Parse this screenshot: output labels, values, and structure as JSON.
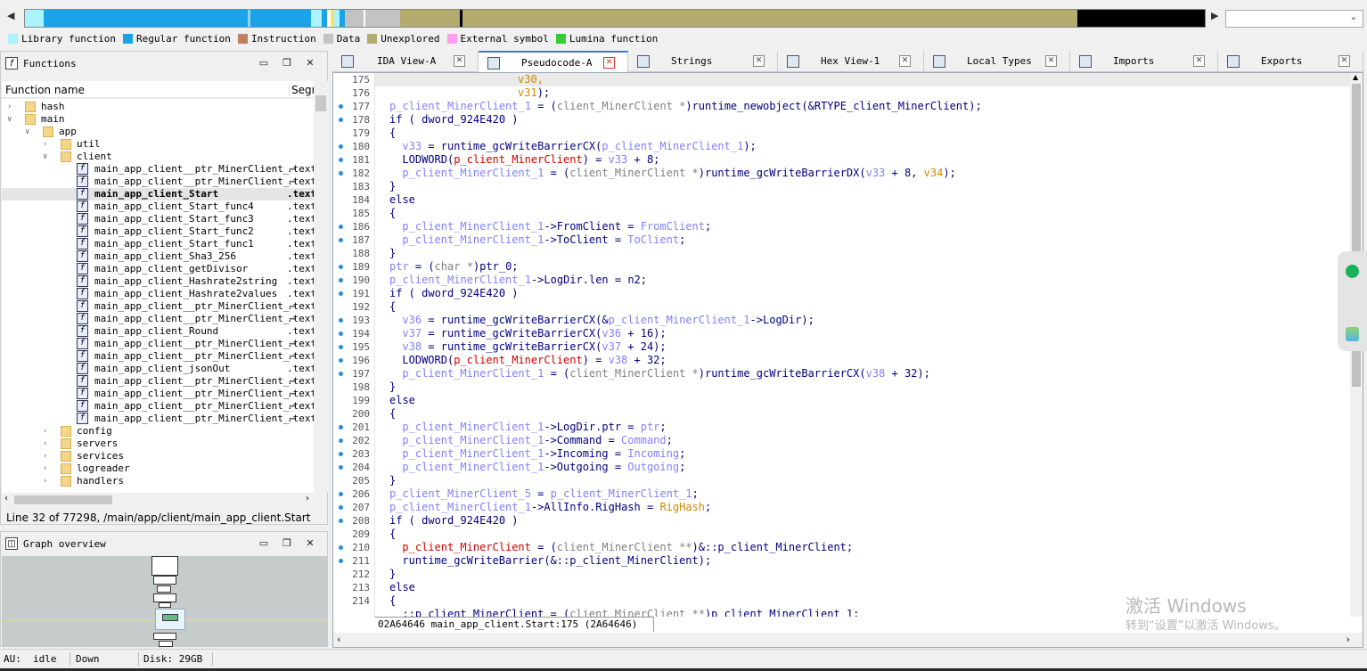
{
  "legend": [
    {
      "label": "Library function",
      "color": "#aaf3ff"
    },
    {
      "label": "Regular function",
      "color": "#1aa3e8"
    },
    {
      "label": "Instruction",
      "color": "#c08060"
    },
    {
      "label": "Data",
      "color": "#c3c3c3"
    },
    {
      "label": "Unexplored",
      "color": "#b4ab6f"
    },
    {
      "label": "External symbol",
      "color": "#ff9ef0"
    },
    {
      "label": "Lumina function",
      "color": "#33cc33"
    }
  ],
  "functions_panel": {
    "title": "Functions",
    "col_name": "Function name",
    "col_segment": "Segr",
    "status": "Line 32 of 77298, /main/app/client/main_app_client.Start",
    "tree": [
      {
        "label": "hash",
        "kind": "folder",
        "depth": 0,
        "expanded": false
      },
      {
        "label": "main",
        "kind": "folder",
        "depth": 0,
        "expanded": true
      },
      {
        "label": "app",
        "kind": "folder",
        "depth": 1,
        "expanded": true
      },
      {
        "label": "util",
        "kind": "folder",
        "depth": 2,
        "expanded": false
      },
      {
        "label": "client",
        "kind": "folder",
        "depth": 2,
        "expanded": true
      },
      {
        "label": "main_app_client__ptr_MinerClient_⋯",
        "kind": "func",
        "seg": ".text"
      },
      {
        "label": "main_app_client__ptr_MinerClient_⋯",
        "kind": "func",
        "seg": ".text"
      },
      {
        "label": "main_app_client_Start",
        "kind": "func",
        "seg": ".text",
        "selected": true
      },
      {
        "label": "main_app_client_Start_func4",
        "kind": "func",
        "seg": ".text"
      },
      {
        "label": "main_app_client_Start_func3",
        "kind": "func",
        "seg": ".text"
      },
      {
        "label": "main_app_client_Start_func2",
        "kind": "func",
        "seg": ".text"
      },
      {
        "label": "main_app_client_Start_func1",
        "kind": "func",
        "seg": ".text"
      },
      {
        "label": "main_app_client_Sha3_256",
        "kind": "func",
        "seg": ".text"
      },
      {
        "label": "main_app_client_getDivisor",
        "kind": "func",
        "seg": ".text"
      },
      {
        "label": "main_app_client_Hashrate2string",
        "kind": "func",
        "seg": ".text"
      },
      {
        "label": "main_app_client_Hashrate2values",
        "kind": "func",
        "seg": ".text"
      },
      {
        "label": "main_app_client__ptr_MinerClient_⋯",
        "kind": "func",
        "seg": ".text"
      },
      {
        "label": "main_app_client__ptr_MinerClient_⋯",
        "kind": "func",
        "seg": ".text"
      },
      {
        "label": "main_app_client_Round",
        "kind": "func",
        "seg": ".text"
      },
      {
        "label": "main_app_client__ptr_MinerClient_⋯",
        "kind": "func",
        "seg": ".text"
      },
      {
        "label": "main_app_client__ptr_MinerClient_⋯",
        "kind": "func",
        "seg": ".text"
      },
      {
        "label": "main_app_client_jsonOut",
        "kind": "func",
        "seg": ".text"
      },
      {
        "label": "main_app_client__ptr_MinerClient_⋯",
        "kind": "func",
        "seg": ".text"
      },
      {
        "label": "main_app_client__ptr_MinerClient_⋯",
        "kind": "func",
        "seg": ".text"
      },
      {
        "label": "main_app_client__ptr_MinerClient_⋯",
        "kind": "func",
        "seg": ".text"
      },
      {
        "label": "main_app_client__ptr_MinerClient_⋯",
        "kind": "func",
        "seg": ".text"
      },
      {
        "label": "config",
        "kind": "folder",
        "depth": 2,
        "expanded": false
      },
      {
        "label": "servers",
        "kind": "folder",
        "depth": 2,
        "expanded": false
      },
      {
        "label": "services",
        "kind": "folder",
        "depth": 2,
        "expanded": false
      },
      {
        "label": "logreader",
        "kind": "folder",
        "depth": 2,
        "expanded": false
      },
      {
        "label": "handlers",
        "kind": "folder",
        "depth": 2,
        "expanded": false
      }
    ]
  },
  "graph_panel": {
    "title": "Graph overview"
  },
  "tabs": [
    {
      "label": "IDA View-A",
      "active": false
    },
    {
      "label": "Pseudocode-A",
      "active": true
    },
    {
      "label": "Strings",
      "active": false
    },
    {
      "label": "Hex View-1",
      "active": false
    },
    {
      "label": "Local Types",
      "active": false
    },
    {
      "label": "Imports",
      "active": false
    },
    {
      "label": "Exports",
      "active": false
    }
  ],
  "code": {
    "status": "02A64646 main_app_client.Start:175 (2A64646)",
    "lines": [
      {
        "n": "175",
        "bp": false,
        "cur": true,
        "t": [
          [
            "v30,",
            "#d08a00",
            "                    "
          ]
        ]
      },
      {
        "n": "176",
        "bp": false,
        "t": [
          [
            "v31",
            "#d08a00",
            "                    "
          ],
          [
            ");",
            "#000080"
          ]
        ]
      },
      {
        "n": "177",
        "bp": true,
        "t": [
          [
            "p_client_MinerClient_1",
            "#8080ff"
          ],
          [
            " = (",
            "#000080"
          ],
          [
            "client_MinerClient *",
            "#808080"
          ],
          [
            ")runtime_newobject(&RTYPE_client_MinerClient);",
            "#000080"
          ]
        ]
      },
      {
        "n": "178",
        "bp": true,
        "t": [
          [
            "if ( ",
            "#000080"
          ],
          [
            "dword_924E420",
            "#000080"
          ],
          [
            " )",
            "#000080"
          ]
        ]
      },
      {
        "n": "179",
        "bp": false,
        "t": [
          [
            "{",
            "#000080"
          ]
        ]
      },
      {
        "n": "180",
        "bp": true,
        "t": [
          [
            "v33",
            "#8080ff",
            "  "
          ],
          [
            " = runtime_gcWriteBarrierCX(",
            "#000080"
          ],
          [
            "p_client_MinerClient_1",
            "#8080ff"
          ],
          [
            ");",
            "#000080"
          ]
        ]
      },
      {
        "n": "181",
        "bp": true,
        "t": [
          [
            "LODWORD(",
            "#000080",
            "  "
          ],
          [
            "p_client_MinerClient",
            "#d00000"
          ],
          [
            ") = ",
            "#000080"
          ],
          [
            "v33",
            "#8080ff"
          ],
          [
            " + 8;",
            "#000080"
          ]
        ]
      },
      {
        "n": "182",
        "bp": true,
        "t": [
          [
            "p_client_MinerClient_1",
            "#8080ff",
            "  "
          ],
          [
            " = (",
            "#000080"
          ],
          [
            "client_MinerClient *",
            "#808080"
          ],
          [
            ")runtime_gcWriteBarrierDX(",
            "#000080"
          ],
          [
            "v33",
            "#8080ff"
          ],
          [
            " + 8, ",
            "#000080"
          ],
          [
            "v34",
            "#d08a00"
          ],
          [
            ");",
            "#000080"
          ]
        ]
      },
      {
        "n": "183",
        "bp": false,
        "t": [
          [
            "}",
            "#000080"
          ]
        ]
      },
      {
        "n": "184",
        "bp": false,
        "t": [
          [
            "else",
            "#000080"
          ]
        ]
      },
      {
        "n": "185",
        "bp": false,
        "t": [
          [
            "{",
            "#000080"
          ]
        ]
      },
      {
        "n": "186",
        "bp": true,
        "t": [
          [
            "p_client_MinerClient_1",
            "#8080ff",
            "  "
          ],
          [
            "->FromClient = ",
            "#000080"
          ],
          [
            "FromClient",
            "#8080ff"
          ],
          [
            ";",
            "#000080"
          ]
        ]
      },
      {
        "n": "187",
        "bp": true,
        "t": [
          [
            "p_client_MinerClient_1",
            "#8080ff",
            "  "
          ],
          [
            "->ToClient = ",
            "#000080"
          ],
          [
            "ToClient",
            "#8080ff"
          ],
          [
            ";",
            "#000080"
          ]
        ]
      },
      {
        "n": "188",
        "bp": false,
        "t": [
          [
            "}",
            "#000080"
          ]
        ]
      },
      {
        "n": "189",
        "bp": true,
        "t": [
          [
            "ptr",
            "#8080ff"
          ],
          [
            " = (",
            "#000080"
          ],
          [
            "char *",
            "#808080"
          ],
          [
            ")ptr_0;",
            "#000080"
          ]
        ]
      },
      {
        "n": "190",
        "bp": true,
        "t": [
          [
            "p_client_MinerClient_1",
            "#8080ff"
          ],
          [
            "->LogDir.len = n2;",
            "#000080"
          ]
        ]
      },
      {
        "n": "191",
        "bp": true,
        "t": [
          [
            "if ( ",
            "#000080"
          ],
          [
            "dword_924E420",
            "#000080"
          ],
          [
            " )",
            "#000080"
          ]
        ]
      },
      {
        "n": "192",
        "bp": false,
        "t": [
          [
            "{",
            "#000080"
          ]
        ]
      },
      {
        "n": "193",
        "bp": true,
        "t": [
          [
            "v36",
            "#8080ff",
            "  "
          ],
          [
            " = runtime_gcWriteBarrierCX(&",
            "#000080"
          ],
          [
            "p_client_MinerClient_1",
            "#8080ff"
          ],
          [
            "->LogDir);",
            "#000080"
          ]
        ]
      },
      {
        "n": "194",
        "bp": true,
        "t": [
          [
            "v37",
            "#8080ff",
            "  "
          ],
          [
            " = runtime_gcWriteBarrierCX(",
            "#000080"
          ],
          [
            "v36",
            "#8080ff"
          ],
          [
            " + 16);",
            "#000080"
          ]
        ]
      },
      {
        "n": "195",
        "bp": true,
        "t": [
          [
            "v38",
            "#8080ff",
            "  "
          ],
          [
            " = runtime_gcWriteBarrierCX(",
            "#000080"
          ],
          [
            "v37",
            "#8080ff"
          ],
          [
            " + 24);",
            "#000080"
          ]
        ]
      },
      {
        "n": "196",
        "bp": true,
        "t": [
          [
            "LODWORD(",
            "#000080",
            "  "
          ],
          [
            "p_client_MinerClient",
            "#d00000"
          ],
          [
            ") = ",
            "#000080"
          ],
          [
            "v38",
            "#8080ff"
          ],
          [
            " + 32;",
            "#000080"
          ]
        ]
      },
      {
        "n": "197",
        "bp": true,
        "t": [
          [
            "p_client_MinerClient_1",
            "#8080ff",
            "  "
          ],
          [
            " = (",
            "#000080"
          ],
          [
            "client_MinerClient *",
            "#808080"
          ],
          [
            ")runtime_gcWriteBarrierCX(",
            "#000080"
          ],
          [
            "v38",
            "#8080ff"
          ],
          [
            " + 32);",
            "#000080"
          ]
        ]
      },
      {
        "n": "198",
        "bp": false,
        "t": [
          [
            "}",
            "#000080"
          ]
        ]
      },
      {
        "n": "199",
        "bp": false,
        "t": [
          [
            "else",
            "#000080"
          ]
        ]
      },
      {
        "n": "200",
        "bp": false,
        "t": [
          [
            "{",
            "#000080"
          ]
        ]
      },
      {
        "n": "201",
        "bp": true,
        "t": [
          [
            "p_client_MinerClient_1",
            "#8080ff",
            "  "
          ],
          [
            "->LogDir.ptr = ",
            "#000080"
          ],
          [
            "ptr",
            "#8080ff"
          ],
          [
            ";",
            "#000080"
          ]
        ]
      },
      {
        "n": "202",
        "bp": true,
        "t": [
          [
            "p_client_MinerClient_1",
            "#8080ff",
            "  "
          ],
          [
            "->Command = ",
            "#000080"
          ],
          [
            "Command",
            "#8080ff"
          ],
          [
            ";",
            "#000080"
          ]
        ]
      },
      {
        "n": "203",
        "bp": true,
        "t": [
          [
            "p_client_MinerClient_1",
            "#8080ff",
            "  "
          ],
          [
            "->Incoming = ",
            "#000080"
          ],
          [
            "Incoming",
            "#8080ff"
          ],
          [
            ";",
            "#000080"
          ]
        ]
      },
      {
        "n": "204",
        "bp": true,
        "t": [
          [
            "p_client_MinerClient_1",
            "#8080ff",
            "  "
          ],
          [
            "->Outgoing = ",
            "#000080"
          ],
          [
            "Outgoing",
            "#8080ff"
          ],
          [
            ";",
            "#000080"
          ]
        ]
      },
      {
        "n": "205",
        "bp": false,
        "t": [
          [
            "}",
            "#000080"
          ]
        ]
      },
      {
        "n": "206",
        "bp": true,
        "t": [
          [
            "p_client_MinerClient_5",
            "#8080ff"
          ],
          [
            " = ",
            "#000080"
          ],
          [
            "p_client_MinerClient_1",
            "#8080ff"
          ],
          [
            ";",
            "#000080"
          ]
        ]
      },
      {
        "n": "207",
        "bp": true,
        "t": [
          [
            "p_client_MinerClient_1",
            "#8080ff"
          ],
          [
            "->AllInfo.RigHash = ",
            "#000080"
          ],
          [
            "RigHash",
            "#d08a00"
          ],
          [
            ";",
            "#000080"
          ]
        ]
      },
      {
        "n": "208",
        "bp": true,
        "t": [
          [
            "if ( ",
            "#000080"
          ],
          [
            "dword_924E420",
            "#000080"
          ],
          [
            " )",
            "#000080"
          ]
        ]
      },
      {
        "n": "209",
        "bp": false,
        "t": [
          [
            "{",
            "#000080"
          ]
        ]
      },
      {
        "n": "210",
        "bp": true,
        "t": [
          [
            "p_client_MinerClient",
            "#d00000",
            "  "
          ],
          [
            " = (",
            "#000080"
          ],
          [
            "client_MinerClient **",
            "#808080"
          ],
          [
            ")&::p_client_MinerClient;",
            "#000080"
          ]
        ]
      },
      {
        "n": "211",
        "bp": true,
        "t": [
          [
            "runtime_gcWriteBarrier(&::p_client_MinerClient);",
            "#000080",
            "  "
          ]
        ]
      },
      {
        "n": "212",
        "bp": false,
        "t": [
          [
            "}",
            "#000080"
          ]
        ]
      },
      {
        "n": "213",
        "bp": false,
        "t": [
          [
            "else",
            "#000080"
          ]
        ]
      },
      {
        "n": "214",
        "bp": false,
        "t": [
          [
            "{",
            "#000080"
          ]
        ]
      },
      {
        "n": "",
        "bp": false,
        "t": [
          [
            "::p_client_MinerClient = (",
            "#000080",
            "  "
          ],
          [
            "client_MinerClient **",
            "#808080"
          ],
          [
            ")p_client_MinerClient_1;",
            "#000080"
          ]
        ]
      }
    ]
  },
  "watermark": {
    "line1": "激活 Windows",
    "line2": "转到“设置”以激活 Windows。"
  },
  "statusbar": {
    "au_label": "AU:",
    "au_value": "idle",
    "direction": "Down",
    "disk": "Disk: 29GB"
  }
}
